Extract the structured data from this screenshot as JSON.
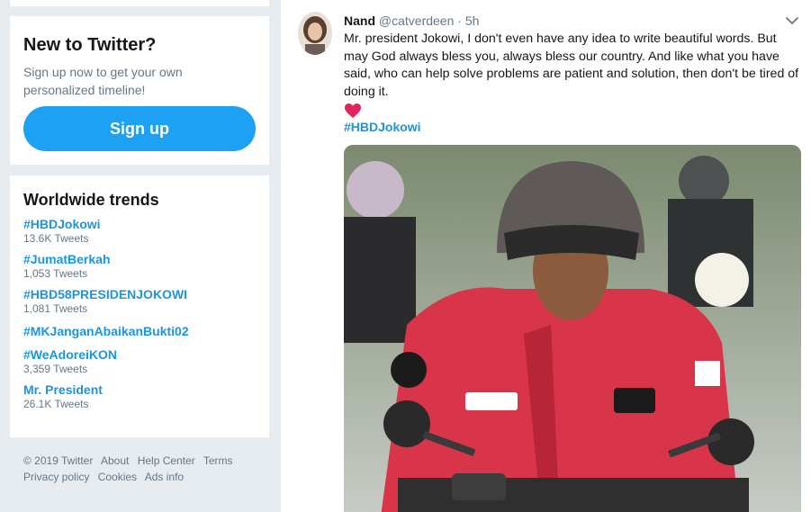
{
  "signup": {
    "title": "New to Twitter?",
    "subtitle": "Sign up now to get your own personalized timeline!",
    "button_label": "Sign up"
  },
  "trends": {
    "title": "Worldwide trends",
    "items": [
      {
        "name": "#HBDJokowi",
        "count": "13.6K Tweets"
      },
      {
        "name": "#JumatBerkah",
        "count": "1,053 Tweets"
      },
      {
        "name": "#HBD58PRESIDENJOKOWI",
        "count": "1,081 Tweets"
      },
      {
        "name": "#MKJanganAbaikanBukti02",
        "count": ""
      },
      {
        "name": "#WeAdoreiKON",
        "count": "3,359 Tweets"
      },
      {
        "name": "Mr. President",
        "count": "26.1K Tweets"
      }
    ]
  },
  "footer": {
    "copyright": "© 2019 Twitter",
    "links": [
      "About",
      "Help Center",
      "Terms",
      "Privacy policy",
      "Cookies",
      "Ads info"
    ]
  },
  "tweet": {
    "author_name": "Nand",
    "author_handle": "@catverdeen",
    "separator": "·",
    "time": "5h",
    "text": "Mr. president Jokowi, I don't even have any idea to write beautiful words. But may God always bless you, always bless our country. And like what you have said, who can help solve problems are patient and solution, then don't be tired of doing it.",
    "hashtag": "#HBDJokowi",
    "emoji": "heart-emoji"
  },
  "colors": {
    "accent": "#1da1f2",
    "link": "#1b95e0",
    "muted": "#657786",
    "background": "#e6ecf0",
    "heart": "#e0245e"
  },
  "icons": [
    "chevron-down-icon",
    "heart-emoji-icon"
  ]
}
